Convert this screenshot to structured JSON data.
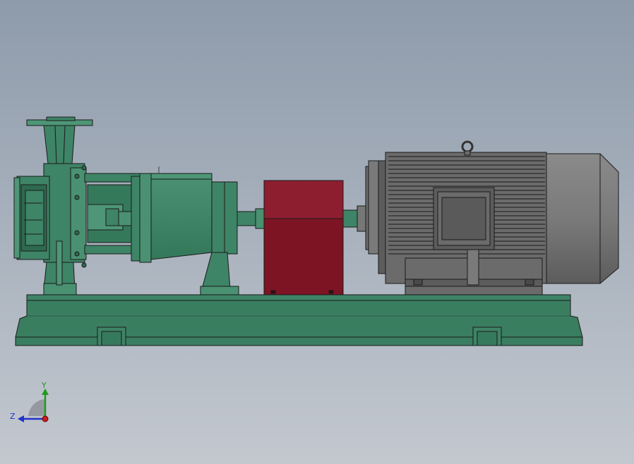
{
  "viewport": {
    "background_top": "#8e9bab",
    "background_bottom": "#c3c8cf"
  },
  "colors": {
    "pump_green": "#3e8466",
    "pump_green_dark": "#2d6a50",
    "pump_green_light": "#4e9677",
    "outline": "#1a1a1a",
    "coupling_guard_red": "#7c1424",
    "coupling_guard_red_top": "#8d1e30",
    "motor_gray": "#6b6b6b",
    "motor_gray_light": "#8a8a8a",
    "motor_gray_dark": "#4a4a4a",
    "axis_x": "#c81e1e",
    "axis_y": "#1e9a1e",
    "axis_z": "#2232c8"
  },
  "triad": {
    "y_label": "Y",
    "z_label": "Z"
  }
}
